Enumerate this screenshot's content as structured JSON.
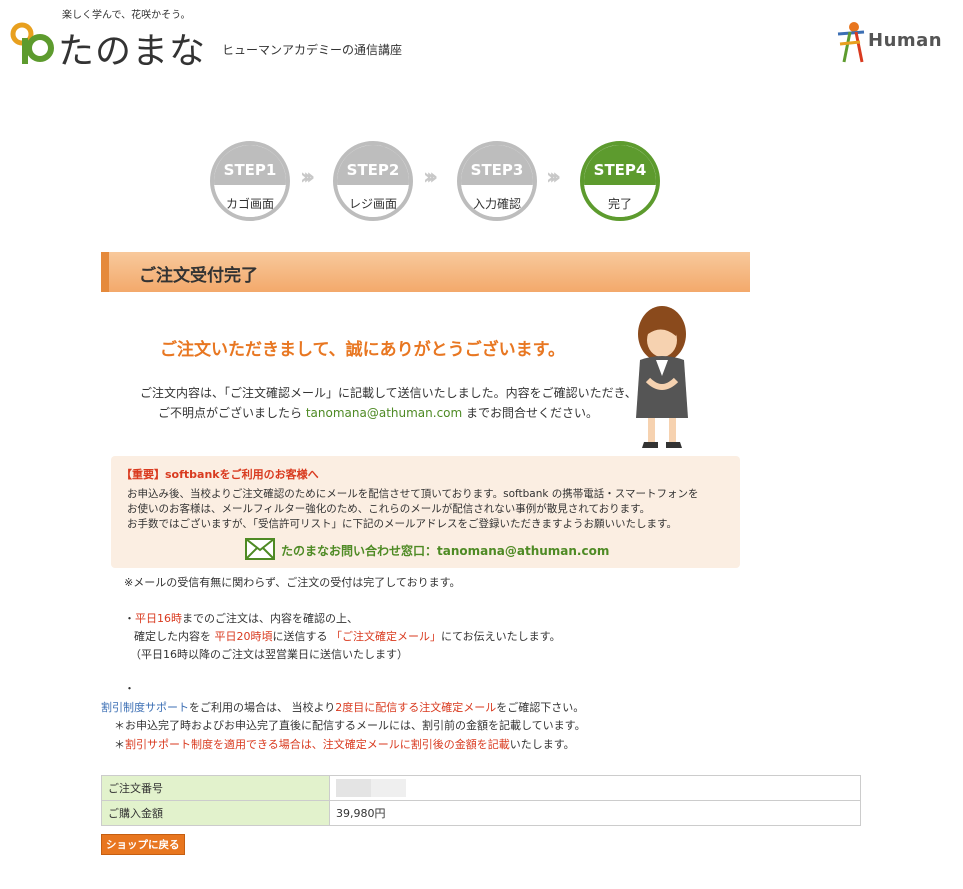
{
  "header": {
    "tagline": "楽しく学んで、花咲かそう。",
    "logo_text": "たのまな",
    "logo_sub": "ヒューマンアカデミーの通信講座",
    "partner_logo": "Human",
    "brand_colors": {
      "green": "#4e8a24",
      "orange": "#e87722"
    }
  },
  "steps": [
    {
      "step": "STEP1",
      "label": "カゴ画面",
      "state": "done"
    },
    {
      "step": "STEP2",
      "label": "レジ画面",
      "state": "done"
    },
    {
      "step": "STEP3",
      "label": "入力確認",
      "state": "done"
    },
    {
      "step": "STEP4",
      "label": "完了",
      "state": "current"
    }
  ],
  "section_title": "ご注文受付完了",
  "thanks": "ご注文いただきまして、誠にありがとうございます。",
  "message": {
    "line1": "ご注文内容は、「ご注文確認メール」に記載して送信いたしました。内容をご確認いただき、",
    "line2_pre": "ご不明点がございましたら ",
    "email": "tanomana@athuman.com",
    "line2_post": " までお問合せください。"
  },
  "notice": {
    "title": "【重要】softbankをご利用のお客様へ",
    "lines": [
      "お申込み後、当校よりご注文確認のためにメールを配信させて頂いております。softbank の携帯電話・スマートフォンを",
      "お使いのお客様は、メールフィルター強化のため、これらのメールが配信されない事例が散見されております。",
      "お手数ではございますが、「受信許可リスト」に下記のメールアドレスをご登録いただきますようお願いいたします。"
    ],
    "contact": "たのまなお問い合わせ窓口：tanomana@athuman.com"
  },
  "note1": "※メールの受信有無に関わらず、ご注文の受付は完了しております。",
  "bullet1": {
    "a_pre": "・",
    "a_red": "平日16時",
    "a_post": "までのご注文は、内容を確認の上、",
    "b_pre": "確定した内容を ",
    "b_red1": "平日20時頃",
    "b_mid": "に送信する ",
    "b_red2": "「ご注文確定メール」",
    "b_post": "にてお伝えいたします。",
    "c": "（平日16時以降のご注文は翌営業日に送信いたします）"
  },
  "dot": "・",
  "discount": {
    "d1_blue": "割引制度サポート",
    "d1_mid": "をご利用の場合は、 当校より",
    "d1_red": "2度目に配信する注文確定メール",
    "d1_post": "をご確認下さい。",
    "d2": "＊お申込完了時およびお申込完了直後に配信するメールには、割引前の金額を記載しています。",
    "d3_pre": "＊",
    "d3_red": "割引サポート制度を適用できる場合は、注文確定メールに割引後の金額を記載",
    "d3_post": "いたします。"
  },
  "order_table": [
    {
      "label": "ご注文番号",
      "value": ""
    },
    {
      "label": "ご購入金額",
      "value": "39,980円"
    }
  ],
  "back_button": "ショップに戻る"
}
